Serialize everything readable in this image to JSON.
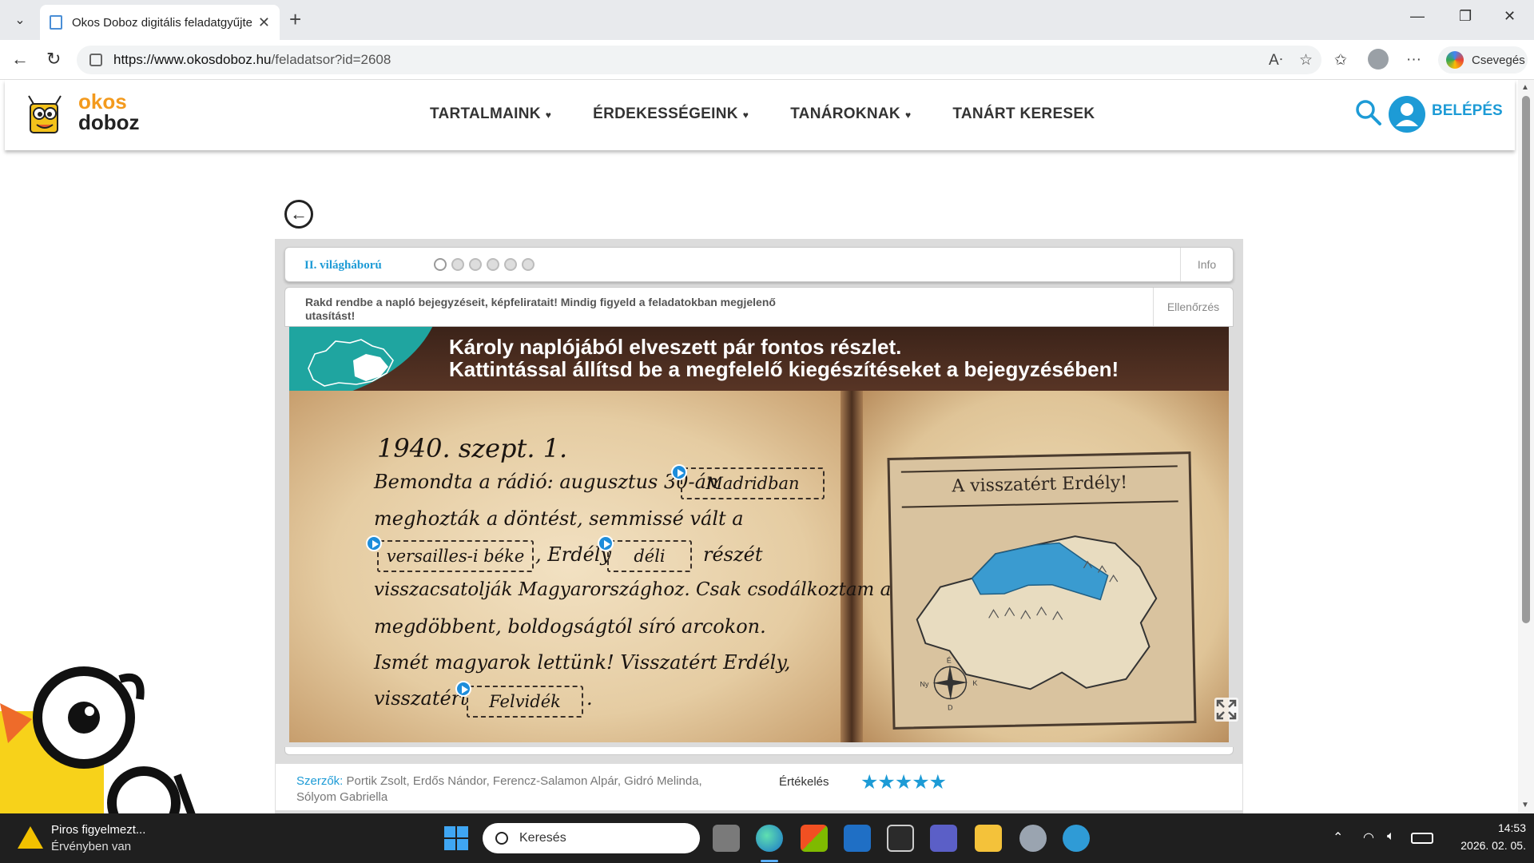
{
  "browser": {
    "tab_title": "Okos Doboz digitális feladatgyűjte",
    "url_host": "https://www.okosdoboz.hu",
    "url_path": "/feladatsor?id=2608",
    "chat_label": "Csevegés"
  },
  "site": {
    "logo_line1": "okos",
    "logo_line2": "doboz",
    "nav": [
      {
        "label": "TARTALMAINK",
        "has_caret": true
      },
      {
        "label": "ÉRDEKESSÉGEINK",
        "has_caret": true
      },
      {
        "label": "TANÁROKNAK",
        "has_caret": true
      },
      {
        "label": "TANÁRT KERESEK",
        "has_caret": false
      }
    ],
    "login_label": "BELÉPÉS",
    "accent": "#1d9bd6",
    "logo_accent": "#f39a1d"
  },
  "exercise": {
    "topic": "II. világháború",
    "progress_dots": 6,
    "info_label": "Info",
    "instruction": "Rakd rendbe a napló bejegyzéseit, képfeliratait! Mindig figyeld a feladatokban megjelenő utasítást!",
    "check_label": "Ellenőrzés",
    "scene_title_line1": "Károly naplójából elveszett pár fontos részlet.",
    "scene_title_line2": "Kattintással állítsd be a megfelelő kiegészítéseket a bejegyzésében!",
    "diary": {
      "date": "1940. szept. 1.",
      "l1": "Bemondta a rádió: augusztus 30-án",
      "l2": "meghozták a döntést, semmissé vált a",
      "l3_mid": ", Erdély",
      "l3_end": "részét",
      "l4": "visszacsatolják Magyarországhoz. Csak csodálkoztam a",
      "l5": "megdöbbent, boldogságtól síró arcokon.",
      "l6": "Ismét magyarok lettünk! Visszatért Erdély,",
      "l7": "visszatért",
      "l7_end": "."
    },
    "blanks": {
      "b1": "Madridban",
      "b2": "versailles-i béke",
      "b3": "déli",
      "b4": "Felvidék"
    },
    "map_title": "A visszatért Erdély!",
    "compass": {
      "n": "É",
      "w": "Ny",
      "e": "K",
      "s": "D"
    }
  },
  "meta": {
    "authors_label": "Szerzők:",
    "authors": "Portik Zsolt, Erdős Nándor, Ferencz-Salamon Alpár, Gidró Melinda, Sólyom Gabriella",
    "rating_label": "Értékelés",
    "stars": "★★★★★",
    "rating": 5
  },
  "taskbar": {
    "warning_title": "Piros figyelmezt...",
    "warning_sub": "Érvényben van",
    "search_placeholder": "Keresés",
    "time": "14:53",
    "date": "2026. 02. 05."
  }
}
